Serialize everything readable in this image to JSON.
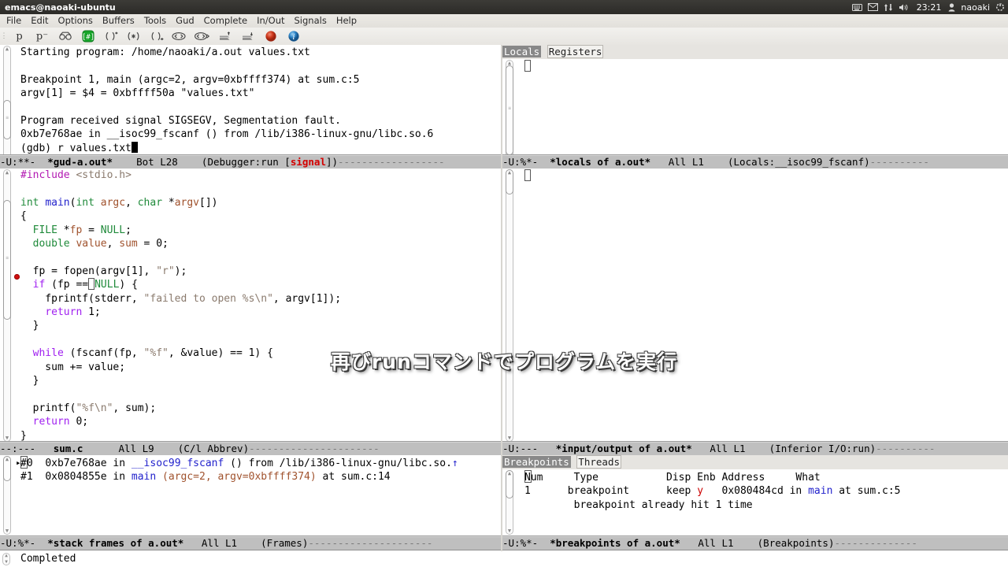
{
  "system": {
    "window_title": "emacs@naoaki-ubuntu",
    "tray": {
      "keyboard_icon": "keyboard-icon",
      "mail_icon": "mail-icon",
      "network_icon": "network-updown-icon",
      "volume_icon": "volume-icon",
      "clock": "23:21",
      "user_icon": "user-icon",
      "username": "naoaki",
      "power_icon": "gear-power-icon"
    }
  },
  "menubar": {
    "items": [
      {
        "label": "File"
      },
      {
        "label": "Edit"
      },
      {
        "label": "Options"
      },
      {
        "label": "Buffers"
      },
      {
        "label": "Tools"
      },
      {
        "label": "Gud"
      },
      {
        "label": "Complete"
      },
      {
        "label": "In/Out"
      },
      {
        "label": "Signals"
      },
      {
        "label": "Help"
      }
    ]
  },
  "toolbar": {
    "items": [
      {
        "name": "gud-print-icon",
        "glyph": "p"
      },
      {
        "name": "gud-print-star-icon",
        "glyph": "p·"
      },
      {
        "name": "gud-watch-icon",
        "glyph": "watch"
      },
      {
        "name": "gud-run-icon",
        "glyph": "run"
      },
      {
        "name": "gud-next-icon",
        "glyph": "{}"
      },
      {
        "name": "gud-step-icon",
        "glyph": "{*}"
      },
      {
        "name": "gud-finish-icon",
        "glyph": "{}>"
      },
      {
        "name": "gud-until-icon",
        "glyph": "<>"
      },
      {
        "name": "gud-cont-icon",
        "glyph": "<*>"
      },
      {
        "name": "gud-up-icon",
        "glyph": "up"
      },
      {
        "name": "gud-down-icon",
        "glyph": "down"
      },
      {
        "name": "gud-stop-icon",
        "glyph": "stop"
      },
      {
        "name": "gud-info-icon",
        "glyph": "i"
      }
    ]
  },
  "gud_window": {
    "lines": [
      "Starting program: /home/naoaki/a.out values.txt",
      "",
      "Breakpoint 1, main (argc=2, argv=0xbffff374) at sum.c:5",
      "argv[1] = $4 = 0xbffff50a \"values.txt\"",
      "",
      "Program received signal SIGSEGV, Segmentation fault.",
      "0xb7e768ae in __isoc99_fscanf () from /lib/i386-linux-gnu/libc.so.6"
    ],
    "prompt": "(gdb) ",
    "command": "r values.txt",
    "modeline": {
      "flags": "-U:**-",
      "buffer": "*gud-a.out*",
      "position": "Bot L28",
      "major_mode_prefix": "(Debugger:run [",
      "signal": "signal",
      "major_mode_suffix": "])"
    }
  },
  "source_window": {
    "filename": "sum.c",
    "breakpoint_line_index": 3,
    "code_lines": [
      "#include <stdio.h>",
      "",
      "int main(int argc, char *argv[])",
      "{",
      "  FILE *fp = NULL;",
      "  double value, sum = 0;",
      "",
      "  fp = fopen(argv[1], \"r\");",
      "  if (fp == NULL) {",
      "    fprintf(stderr, \"failed to open %s\\n\", argv[1]);",
      "    return 1;",
      "  }",
      "",
      "  while (fscanf(fp, \"%f\", &value) == 1) {",
      "    sum += value;",
      "  }",
      "",
      "  printf(\"%f\\n\", sum);",
      "  return 0;",
      "}"
    ],
    "modeline": {
      "flags": "--:---",
      "buffer": "sum.c",
      "position": "All L9",
      "major_mode": "(C/l Abbrev)"
    }
  },
  "stack_window": {
    "rows": [
      {
        "marker": "▸",
        "num": "#0",
        "addr": "0xb7e768ae",
        "in": "in",
        "func": "__isoc99_fscanf",
        "rest": " () from /lib/i386-linux-gnu/libc.so.",
        "truncated": "↑"
      },
      {
        "marker": " ",
        "num": "#1",
        "addr": "0x0804855e",
        "in": "in",
        "func": "main",
        "args": " (argc=2, argv=0xbffff374)",
        "rest": " at sum.c:14"
      }
    ],
    "modeline": {
      "flags": "-U:%*-",
      "buffer": "*stack frames of a.out*",
      "position": "All L1",
      "major_mode": "(Frames)"
    }
  },
  "locals_window": {
    "tabs": [
      {
        "label": "Locals",
        "selected": true
      },
      {
        "label": "Registers",
        "selected": false
      }
    ],
    "content": "",
    "modeline": {
      "flags": "-U:%*-",
      "buffer": "*locals of a.out*",
      "position": "All L1",
      "major_mode": "(Locals:__isoc99_fscanf)"
    }
  },
  "io_window": {
    "content": "",
    "modeline": {
      "flags": "-U:---",
      "buffer": "*input/output of a.out*",
      "position": "All L1",
      "major_mode": "(Inferior I/O:run)"
    }
  },
  "breakpoints_window": {
    "tabs": [
      {
        "label": "Breakpoints",
        "selected": true
      },
      {
        "label": "Threads",
        "selected": false
      }
    ],
    "columns": [
      "Num",
      "Type",
      "Disp",
      "Enb",
      "Address",
      "What"
    ],
    "rows": [
      {
        "num": "1",
        "type": "breakpoint",
        "disp": "keep",
        "enb": "y",
        "address": "0x080484cd",
        "what_in": "in",
        "what_func": "main",
        "what_at": "at sum.c:5"
      }
    ],
    "note": "breakpoint already hit 1 time",
    "modeline": {
      "flags": "-U:%*-",
      "buffer": "*breakpoints of a.out*",
      "position": "All L1",
      "major_mode": "(Breakpoints)"
    }
  },
  "echo_area": {
    "message": "Completed"
  },
  "subtitle": {
    "text": "再びrunコマンドでプログラムを実行"
  },
  "colors": {
    "modeline_bg": "#bfbfbf",
    "signal_red": "#d40000",
    "breakpoint_red": "#d01010",
    "keyword_purple": "#a020f0",
    "type_green": "#1f8a3a",
    "function_blue": "#2222cc",
    "string_brown": "#8a7a6d",
    "preproc_magenta": "#b218b2"
  }
}
